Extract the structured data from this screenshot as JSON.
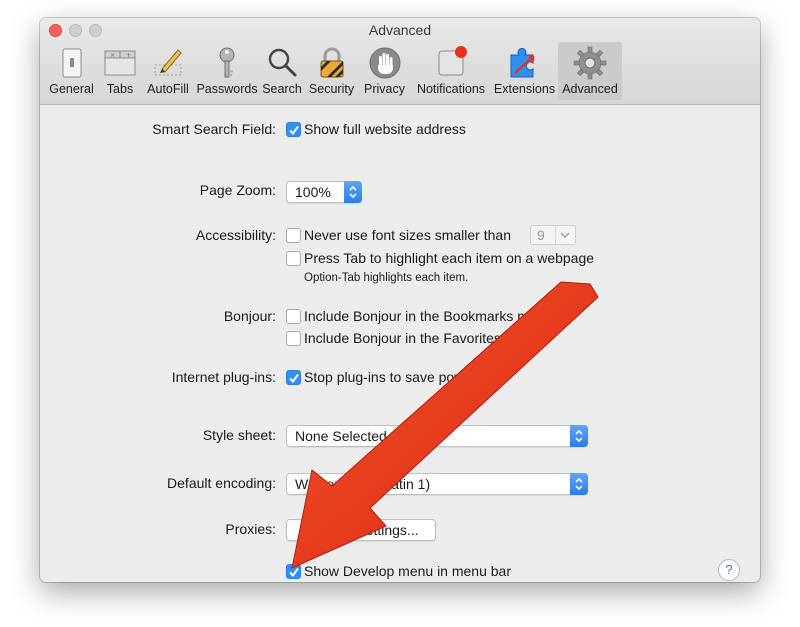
{
  "window": {
    "title": "Advanced",
    "toolbar": [
      {
        "label": "General",
        "icon": "general-icon"
      },
      {
        "label": "Tabs",
        "icon": "tabs-icon"
      },
      {
        "label": "AutoFill",
        "icon": "autofill-icon"
      },
      {
        "label": "Passwords",
        "icon": "key-icon"
      },
      {
        "label": "Search",
        "icon": "search-icon"
      },
      {
        "label": "Security",
        "icon": "lock-icon"
      },
      {
        "label": "Privacy",
        "icon": "hand-icon"
      },
      {
        "label": "Notifications",
        "icon": "notification-icon"
      },
      {
        "label": "Extensions",
        "icon": "puzzle-icon"
      },
      {
        "label": "Advanced",
        "icon": "gear-icon"
      }
    ],
    "active_tab": "Advanced"
  },
  "settings": {
    "smart_search": {
      "label": "Smart Search Field:",
      "option": "Show full website address",
      "checked": true
    },
    "page_zoom": {
      "label": "Page Zoom:",
      "value": "100%"
    },
    "accessibility": {
      "label": "Accessibility:",
      "font_size": {
        "option": "Never use font sizes smaller than",
        "checked": false,
        "value": "9"
      },
      "tab_highlight": {
        "option": "Press Tab to highlight each item on a webpage",
        "checked": false
      },
      "hint": "Option-Tab highlights each item."
    },
    "bonjour": {
      "label": "Bonjour:",
      "bookmarks": {
        "option": "Include Bonjour in the Bookmarks menu",
        "checked": false
      },
      "favorites": {
        "option": "Include Bonjour in the Favorites bar",
        "checked": false
      }
    },
    "plugins": {
      "label": "Internet plug-ins:",
      "option": "Stop plug-ins to save power",
      "checked": true
    },
    "style_sheet": {
      "label": "Style sheet:",
      "value": "None Selected"
    },
    "encoding": {
      "label": "Default encoding:",
      "value": "Western (ISO Latin 1)"
    },
    "proxies": {
      "label": "Proxies:",
      "button": "Change Settings..."
    },
    "develop": {
      "option": "Show Develop menu in menu bar",
      "checked": true
    }
  },
  "help": {
    "label": "?"
  },
  "colors": {
    "accent": "#2f8ff2",
    "arrow": "#e8321c",
    "close": "#fc605c"
  }
}
